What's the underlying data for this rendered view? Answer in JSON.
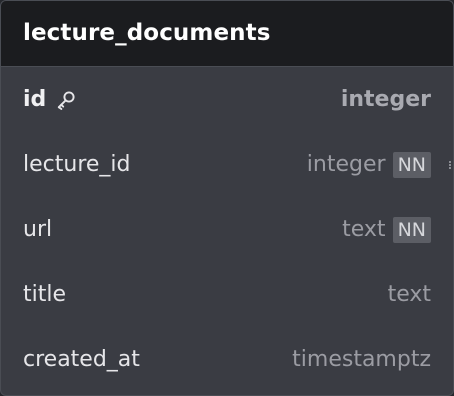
{
  "table": {
    "name": "lecture_documents",
    "columns": [
      {
        "name": "id",
        "type": "integer",
        "primary_key": true,
        "icon": "key-icon",
        "not_null": false
      },
      {
        "name": "lecture_id",
        "type": "integer",
        "primary_key": false,
        "not_null": true,
        "badge": "NN"
      },
      {
        "name": "url",
        "type": "text",
        "primary_key": false,
        "not_null": true,
        "badge": "NN"
      },
      {
        "name": "title",
        "type": "text",
        "primary_key": false,
        "not_null": false
      },
      {
        "name": "created_at",
        "type": "timestamptz",
        "primary_key": false,
        "not_null": false
      }
    ]
  },
  "colors": {
    "header_bg": "#1b1c1f",
    "body_bg": "#3a3c43",
    "badge_bg": "#5c5e65"
  }
}
